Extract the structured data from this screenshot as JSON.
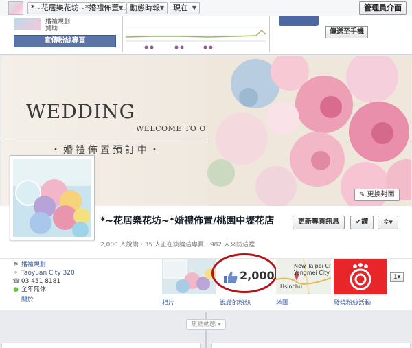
{
  "admin_bar": {
    "page_name": "*~花居樂花坊~*婚禮佈置...",
    "activity_label": "動態時報",
    "now_label": "現在",
    "admin_panel_label": "管理員介面"
  },
  "admin_strip": {
    "card_text": "贊助",
    "card_text_top": "婚禮規劃",
    "promote_label": "宣傳粉絲專頁",
    "send_to_phone_label": "傳送至手機"
  },
  "cover": {
    "title": "WEDDING",
    "subtitle": "WELCOME TO OUR PARTY",
    "tagline": "・婚禮佈置預訂中・",
    "change_cover_label": "更換封面"
  },
  "page": {
    "name": "*~花居樂花坊~*婚禮佈置/桃園中壢花店",
    "stats": "2,000 人說讚・35 人正在談論這專頁・982 人來訪這裡",
    "update_info_label": "更新專頁訊息",
    "liked_label": "讚",
    "settings_label": "✲"
  },
  "info": {
    "category": "婚禮規劃",
    "city": "Taoyuan City 320",
    "phone": "03 451 8181",
    "hours": "全年無休",
    "about": "關於"
  },
  "tiles": {
    "photos_label": "相片",
    "likes_label": "說讚的粉絲",
    "likes_count": "2,000",
    "map_label": "地圖",
    "map_city_1": "New Taipei City",
    "map_city_2": "Yangmei City",
    "map_city_3": "Hsinchu",
    "promo_label": "發燒粉絲活動",
    "more_label": "1"
  },
  "timeline": {
    "pill_label": "焦點動態"
  },
  "colors": {
    "fb_blue": "#3b5998",
    "annotation_red": "#b3131a",
    "promo_red": "#e8262a"
  }
}
